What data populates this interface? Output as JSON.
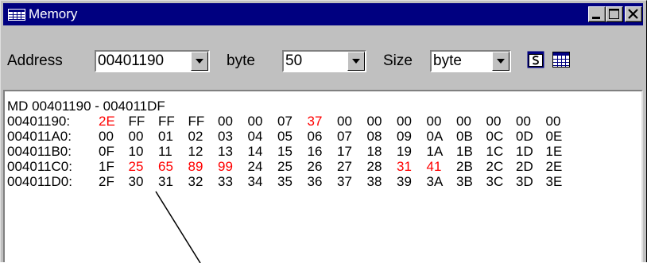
{
  "window": {
    "title": "Memory",
    "icon": "grid-icon"
  },
  "toolbar": {
    "address_label": "Address",
    "address_value": "00401190",
    "unit_label": "byte",
    "count_value": "50",
    "size_label": "Size",
    "size_value": "byte",
    "string_button_icon": "s-icon",
    "table_button_icon": "table-icon"
  },
  "memory": {
    "header": "MD 00401190 - 004011DF",
    "highlight_color": "#ff0000",
    "rows": [
      {
        "address": "00401190:",
        "bytes": [
          "2E",
          "FF",
          "FF",
          "FF",
          "00",
          "00",
          "07",
          "37",
          "00",
          "00",
          "00",
          "00",
          "00",
          "00",
          "00",
          "00"
        ],
        "highlighted": [
          0,
          7
        ]
      },
      {
        "address": "004011A0:",
        "bytes": [
          "00",
          "00",
          "01",
          "02",
          "03",
          "04",
          "05",
          "06",
          "07",
          "08",
          "09",
          "0A",
          "0B",
          "0C",
          "0D",
          "0E"
        ],
        "highlighted": []
      },
      {
        "address": "004011B0:",
        "bytes": [
          "0F",
          "10",
          "11",
          "12",
          "13",
          "14",
          "15",
          "16",
          "17",
          "18",
          "19",
          "1A",
          "1B",
          "1C",
          "1D",
          "1E"
        ],
        "highlighted": []
      },
      {
        "address": "004011C0:",
        "bytes": [
          "1F",
          "25",
          "65",
          "89",
          "99",
          "24",
          "25",
          "26",
          "27",
          "28",
          "31",
          "41",
          "2B",
          "2C",
          "2D",
          "2E"
        ],
        "highlighted": [
          1,
          2,
          3,
          4,
          10,
          11
        ]
      },
      {
        "address": "004011D0:",
        "bytes": [
          "2F",
          "30",
          "31",
          "32",
          "33",
          "34",
          "35",
          "36",
          "37",
          "38",
          "39",
          "3A",
          "3B",
          "3C",
          "3D",
          "3E"
        ],
        "highlighted": []
      }
    ]
  }
}
